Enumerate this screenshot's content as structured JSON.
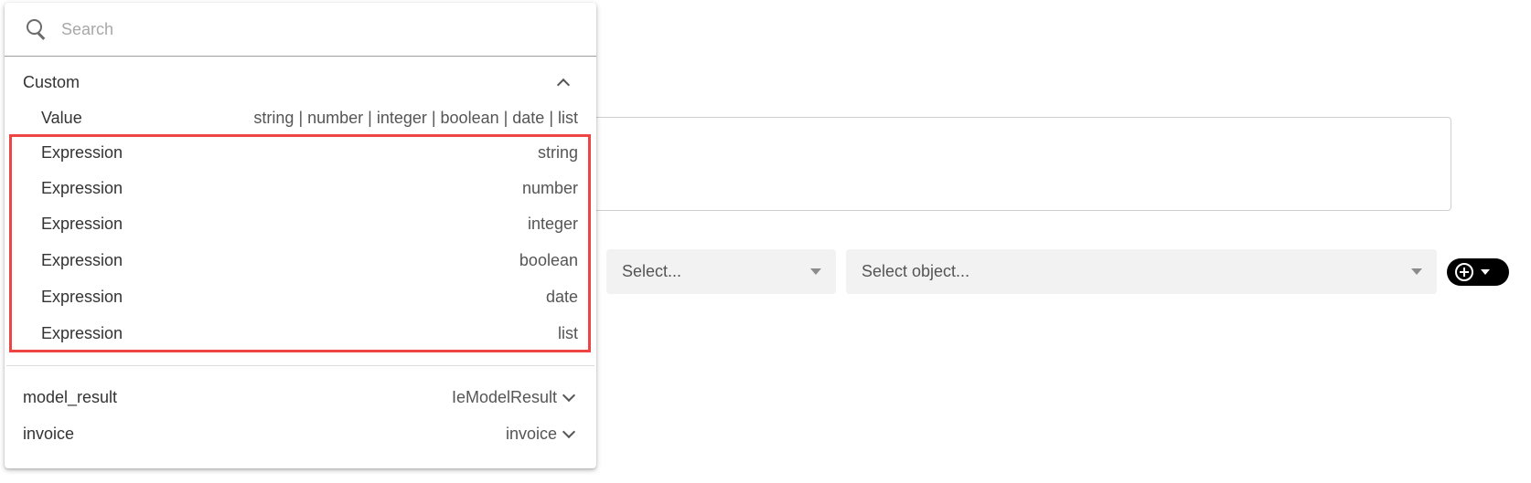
{
  "dropdown": {
    "search": {
      "placeholder": "Search",
      "value": ""
    },
    "custom_group": {
      "label": "Custom",
      "value_option": {
        "label": "Value",
        "type": "string | number | integer | boolean | date | list"
      },
      "expressions": [
        {
          "label": "Expression",
          "type": "string"
        },
        {
          "label": "Expression",
          "type": "number"
        },
        {
          "label": "Expression",
          "type": "integer"
        },
        {
          "label": "Expression",
          "type": "boolean"
        },
        {
          "label": "Expression",
          "type": "date"
        },
        {
          "label": "Expression",
          "type": "list"
        }
      ]
    },
    "variables": [
      {
        "label": "model_result",
        "type": "IeModelResult"
      },
      {
        "label": "invoice",
        "type": "invoice"
      }
    ]
  },
  "form": {
    "select_1": {
      "placeholder": "Select..."
    },
    "select_2": {
      "placeholder": "Select object..."
    }
  },
  "colors": {
    "highlight": "#ef4444",
    "add_button": "#000000",
    "select_bg": "#f2f2f2"
  }
}
